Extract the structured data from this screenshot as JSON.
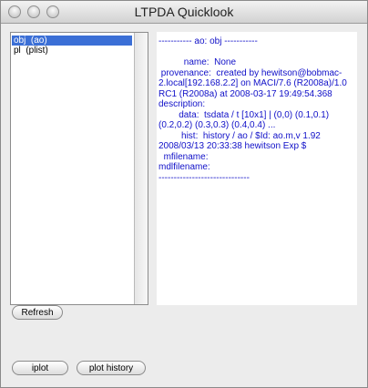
{
  "window": {
    "title": "LTPDA Quicklook"
  },
  "object_list": {
    "items": [
      {
        "label": "obj  (ao)",
        "selected": true
      },
      {
        "label": "pl  (plist)",
        "selected": false
      }
    ]
  },
  "info_panel": {
    "text": "----------- ao: obj -----------\n\n          name:  None\n provenance:  created by hewitson@bobmac-2.local[192.168.2.2] on MACI/7.6 (R2008a)/1.0 RC1 (R2008a) at 2008-03-17 19:49:54.368\ndescription: \n        data:  tsdata / t [10x1] | (0,0) (0.1,0.1) (0.2,0.2) (0.3,0.3) (0.4,0.4) ...\n         hist:  history / ao / $Id: ao.m,v 1.92 2008/03/13 20:33:38 hewitson Exp $\n  mfilename: \nmdlfilename: \n------------------------------"
  },
  "buttons": {
    "refresh": "Refresh",
    "iplot": "iplot",
    "plot_history": "plot history"
  },
  "colors": {
    "info_text": "#1010c8",
    "selection": "#3b6fd6"
  }
}
